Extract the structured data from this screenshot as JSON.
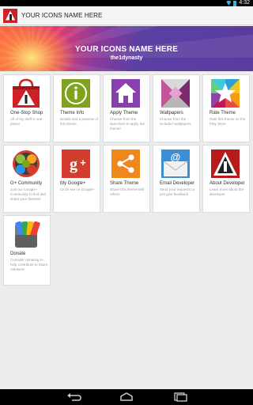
{
  "status_bar": {
    "time": "4:32"
  },
  "action_bar": {
    "title": "YOUR ICONS NAME HERE"
  },
  "banner": {
    "title": "YOUR ICONS NAME HERE",
    "subtitle": "the1dynasty"
  },
  "tiles": [
    {
      "title": "One-Stop Shop",
      "desc": "All of my stuff in one place!",
      "icon": "shopping-bag-icon"
    },
    {
      "title": "Theme Info",
      "desc": "Details and a preview of this theme",
      "icon": "info-icon"
    },
    {
      "title": "Apply Theme",
      "desc": "Choose from the launchers to apply the theme!",
      "icon": "home-icon"
    },
    {
      "title": "Wallpapers",
      "desc": "Choose from the included wallpapers",
      "icon": "wallpaper-icon"
    },
    {
      "title": "Rate Theme",
      "desc": "Rate this theme on the Play Store",
      "icon": "star-icon"
    },
    {
      "title": "G+ Community",
      "desc": "Join our Google+ Community to find and share your themes!",
      "icon": "community-icon"
    },
    {
      "title": "My Google+",
      "desc": "Circle me on Google+",
      "icon": "google-plus-icon"
    },
    {
      "title": "Share Theme",
      "desc": "Share this theme with others",
      "icon": "share-icon"
    },
    {
      "title": "Email Developer",
      "desc": "Send your requests or just give feedback",
      "icon": "email-icon"
    },
    {
      "title": "About Developer",
      "desc": "Learn more about the developer",
      "icon": "about-logo-icon"
    },
    {
      "title": "Donate",
      "desc": "Consider donating to help contribute to future releases!",
      "icon": "wallet-icon"
    }
  ],
  "colors": {
    "accent_red": "#ce2127",
    "info_green": "#7fa31c",
    "apply_purple": "#8a3fb0",
    "share_orange": "#f0871c",
    "gplus_red": "#d13e2e",
    "email_blue": "#3a8fd6",
    "banner_purple": "#5a3c9e"
  }
}
